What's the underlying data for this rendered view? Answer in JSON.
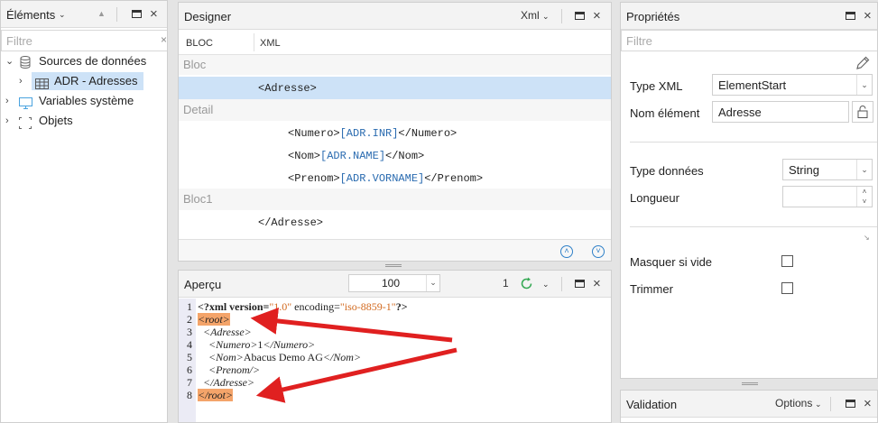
{
  "elements_panel": {
    "title": "Éléments",
    "filter_placeholder": "Filtre",
    "tree": [
      {
        "label": "Sources de données",
        "icon": "database-icon",
        "expanded": true
      },
      {
        "label": "ADR - Adresses",
        "icon": "table-icon",
        "selected": true
      },
      {
        "label": "Variables système",
        "icon": "monitor-icon"
      },
      {
        "label": "Objets",
        "icon": "object-icon"
      }
    ]
  },
  "designer": {
    "title": "Designer",
    "mode": "Xml",
    "columns": {
      "bloc": "BLOC",
      "xml": "XML"
    },
    "rows": {
      "bloc": "Bloc",
      "adresse_open": "<Adresse>",
      "detail": "Detail",
      "numero_open": "<Numero>",
      "numero_bind": "[ADR.INR]",
      "numero_close": "</Numero>",
      "nom_open": "<Nom>",
      "nom_bind": "[ADR.NAME]",
      "nom_close": "</Nom>",
      "prenom_open": "<Prenom>",
      "prenom_bind": "[ADR.VORNAME]",
      "prenom_close": "</Prenom>",
      "bloc1": "Bloc1",
      "adresse_close": "</Adresse>"
    }
  },
  "apercu": {
    "title": "Aperçu",
    "zoom": "100",
    "page": "1",
    "lines": {
      "l1_a": "<?xml version=",
      "l1_b": "\"1.0\"",
      "l1_c": " encoding=",
      "l1_d": "\"iso-8859-1\"",
      "l1_e": "?>",
      "l2": "<root>",
      "l3": "<Adresse>",
      "l4_a": "<Numero>",
      "l4_b": "1",
      "l4_c": "</Numero>",
      "l5_a": "<Nom>",
      "l5_b": "Abacus Demo AG",
      "l5_c": "</Nom>",
      "l6": "<Prenom/>",
      "l7": "</Adresse>",
      "l8": "</root>"
    },
    "line_numbers": [
      "1",
      "2",
      "3",
      "4",
      "5",
      "6",
      "7",
      "8"
    ]
  },
  "proprietes": {
    "title": "Propriétés",
    "filter_placeholder": "Filtre",
    "type_xml_label": "Type XML",
    "type_xml_value": "ElementStart",
    "nom_element_label": "Nom élément",
    "nom_element_value": "Adresse",
    "type_donnees_label": "Type données",
    "type_donnees_value": "String",
    "longueur_label": "Longueur",
    "longueur_value": "",
    "masquer_label": "Masquer si vide",
    "trimmer_label": "Trimmer"
  },
  "validation": {
    "title": "Validation",
    "options": "Options"
  },
  "colors": {
    "selected_row": "#cde2f7",
    "highlight": "#f4a46a",
    "arrow": "#e02020",
    "bind_text": "#2a6bb0"
  }
}
